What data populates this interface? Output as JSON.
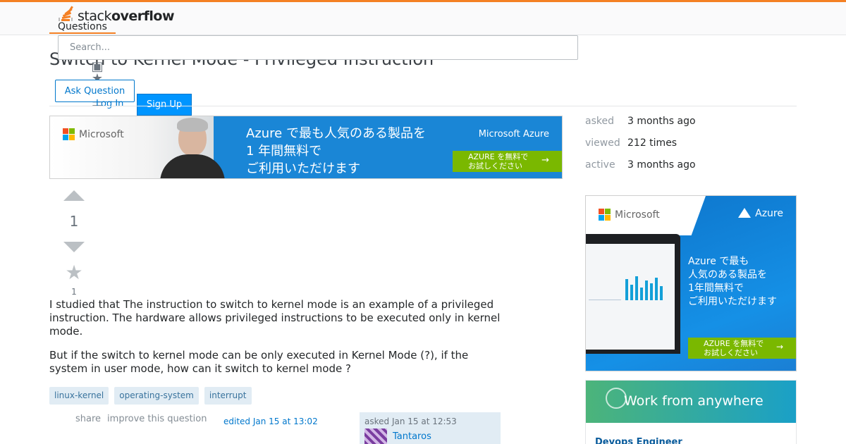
{
  "brand": {
    "logo_regular": "stack",
    "logo_bold": "overflow"
  },
  "nav": {
    "questions_tab": "Questions"
  },
  "search": {
    "placeholder": "Search..."
  },
  "question": {
    "title": "Switch to Kernel Mode - Privileged Instruction",
    "vote_count": "1",
    "favorite_count": "1",
    "body": [
      "I studied that The instruction to switch to kernel mode is an example of a privileged instruction. The hardware allows privileged instructions to be executed only in kernel mode.",
      "But if the switch to kernel mode can be only executed in Kernel Mode (?), if the system in user mode, how can it switch to kernel mode ?"
    ],
    "tags": [
      "linux-kernel",
      "operating-system",
      "interrupt"
    ],
    "menu": {
      "share": "share",
      "improve": "improve this question"
    },
    "edited": "edited Jan 15 at 13:02",
    "asked": "asked Jan 15 at 12:53",
    "owner_name": "Tantaros"
  },
  "actions": {
    "ask_question": "Ask Question",
    "log_in": "Log In",
    "sign_up": "Sign Up"
  },
  "stats": [
    {
      "label": "asked",
      "value": "3 months ago"
    },
    {
      "label": "viewed",
      "value": "212 times"
    },
    {
      "label": "active",
      "value": "3 months ago"
    }
  ],
  "top_ad": {
    "brand": "Microsoft",
    "product": "Microsoft Azure",
    "line1": "Azure で最も人気のある製品を",
    "line2": "1 年間無料で",
    "line3": "ご利用いただけます",
    "cta_line1": "AZURE を無料で",
    "cta_line2": "お試しください",
    "cta_arrow": "→"
  },
  "side_ad": {
    "brand": "Microsoft",
    "product": "Azure",
    "line1": "Azure で最も",
    "line2": "人気のある製品を",
    "line3": "1年間無料で",
    "line4": "ご利用いただけます",
    "cta_line1": "AZURE を無料で",
    "cta_line2": "お試しください",
    "cta_arrow": "→"
  },
  "jobs": {
    "title": "Work from anywhere",
    "role": "Devops Engineer"
  },
  "icons": {
    "up": "vote-up-icon",
    "down": "vote-down-icon",
    "star": "star-icon",
    "stack_glyph": "⚙"
  },
  "colors": {
    "accent": "#f48024",
    "link": "#0077cc",
    "tag_bg": "#e1ecf4",
    "signup_bg": "#0095ff"
  }
}
